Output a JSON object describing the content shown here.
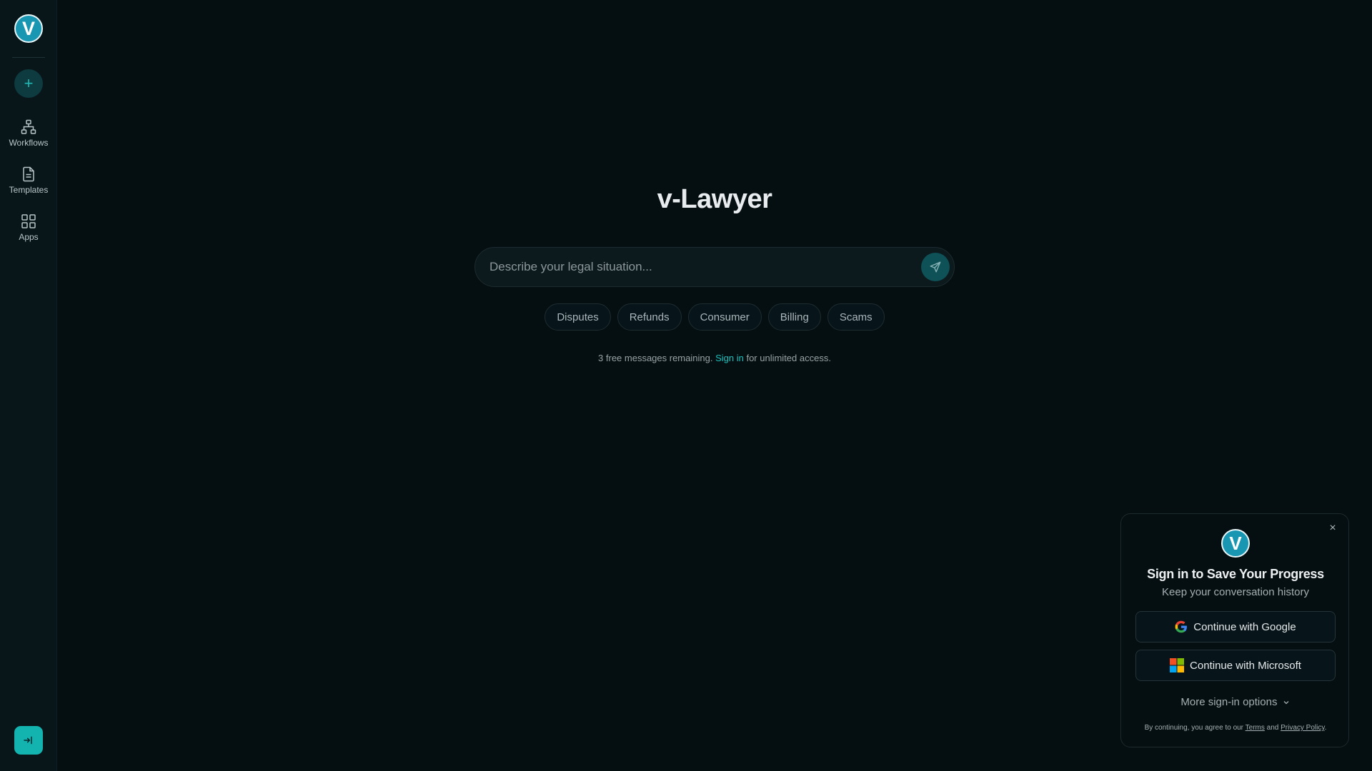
{
  "sidebar": {
    "logo_letter": "V",
    "new_label": "+",
    "items": [
      {
        "label": "Workflows",
        "icon": "workflow-icon"
      },
      {
        "label": "Templates",
        "icon": "document-icon"
      },
      {
        "label": "Apps",
        "icon": "grid-icon"
      }
    ],
    "signin_icon": "sign-in-icon"
  },
  "main": {
    "title": "v-Lawyer",
    "search": {
      "placeholder": "Describe your legal situation...",
      "value": ""
    },
    "chips": [
      "Disputes",
      "Refunds",
      "Consumer",
      "Billing",
      "Scams"
    ],
    "free_note": {
      "prefix": "3 free messages remaining.",
      "link": "Sign in",
      "suffix": "for unlimited access."
    }
  },
  "signin_card": {
    "close": "×",
    "logo_letter": "V",
    "title": "Sign in to Save Your Progress",
    "subtitle": "Keep your conversation history",
    "google": "Continue with Google",
    "microsoft": "Continue with Microsoft",
    "more": "More sign-in options",
    "terms_prefix": "By continuing, you agree to our",
    "terms_link": "Terms",
    "terms_and": "and",
    "privacy_link": "Privacy Policy",
    "terms_suffix": "."
  },
  "colors": {
    "background": "#050e11",
    "sidebar": "#08161a",
    "accent": "#13b4b0",
    "logo": "#1896b2"
  }
}
